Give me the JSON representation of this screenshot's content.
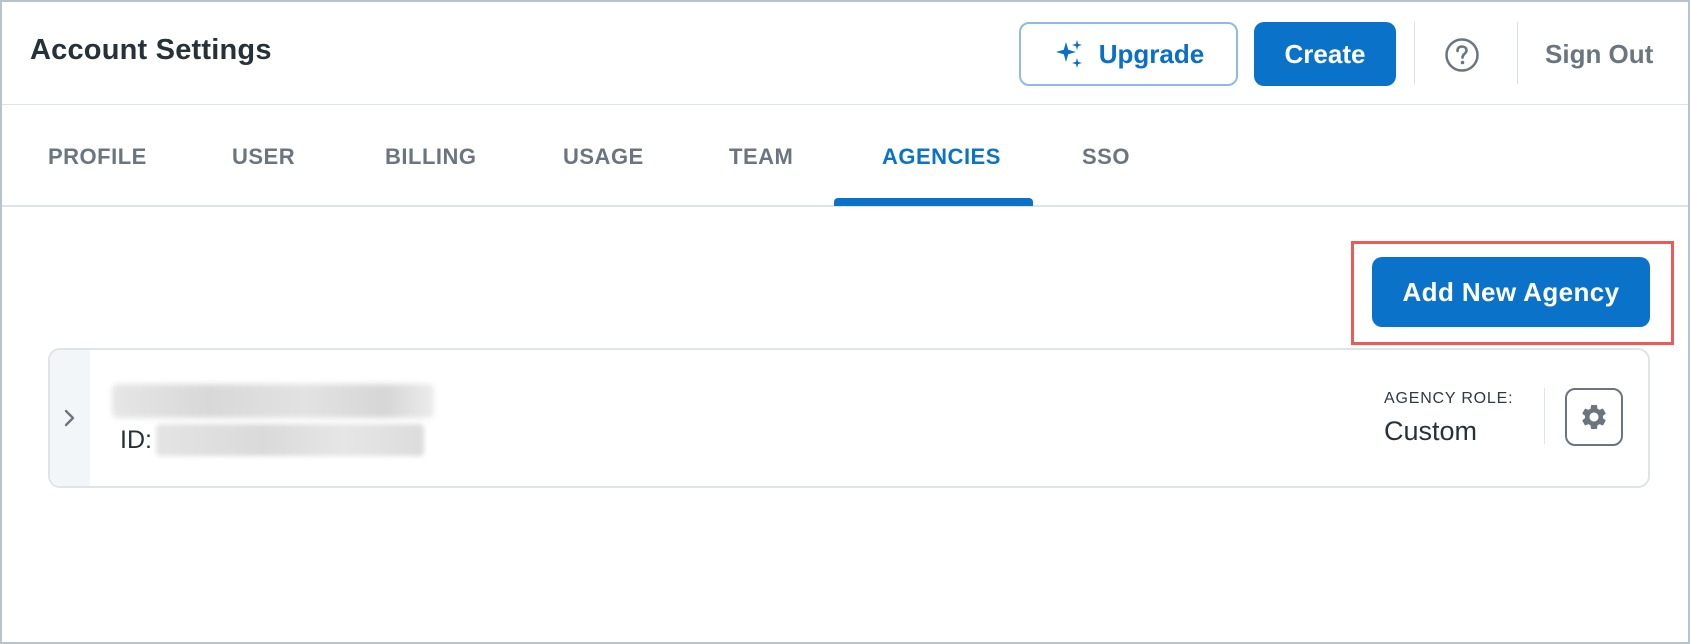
{
  "header": {
    "title": "Account Settings",
    "upgrade_label": "Upgrade",
    "create_label": "Create",
    "signout_label": "Sign Out"
  },
  "tabs": [
    {
      "label": "PROFILE",
      "active": false
    },
    {
      "label": "USER",
      "active": false
    },
    {
      "label": "BILLING",
      "active": false
    },
    {
      "label": "USAGE",
      "active": false
    },
    {
      "label": "TEAM",
      "active": false
    },
    {
      "label": "AGENCIES",
      "active": true
    },
    {
      "label": "SSO",
      "active": false
    }
  ],
  "agencies": {
    "add_label": "Add New Agency",
    "card": {
      "id_label": "ID:",
      "role_label": "AGENCY ROLE:",
      "role_value": "Custom"
    }
  },
  "colors": {
    "primary": "#0b72c9",
    "highlight": "#ec5b55",
    "muted_text": "#6b7580"
  },
  "icons": {
    "upgrade": "sparkles-icon",
    "help": "help-circle-icon",
    "expand": "chevron-right-icon",
    "settings": "gear-icon"
  }
}
